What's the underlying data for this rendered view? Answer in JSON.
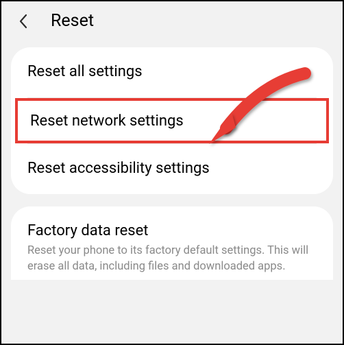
{
  "header": {
    "title": "Reset"
  },
  "sections": {
    "primary": {
      "items": [
        {
          "title": "Reset all settings"
        },
        {
          "title": "Reset network settings"
        },
        {
          "title": "Reset accessibility settings"
        }
      ]
    },
    "factory": {
      "title": "Factory data reset",
      "subtitle": "Reset your phone to its factory default settings. This will erase all data, including files and downloaded apps."
    }
  },
  "annotation": {
    "highlight_color": "#e73c34",
    "arrow_color": "#e73c34"
  }
}
